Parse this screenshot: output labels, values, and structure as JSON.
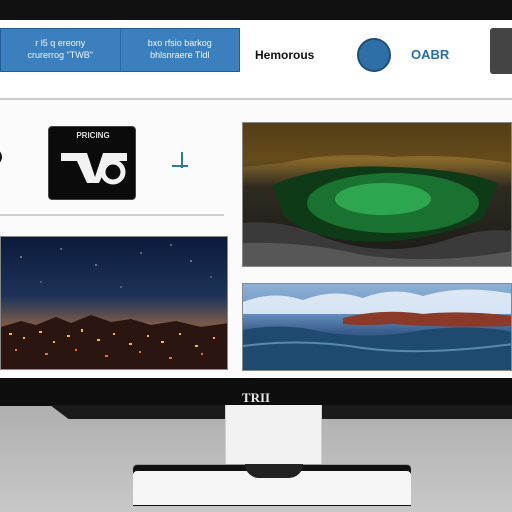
{
  "header": {
    "nav_items": [
      {
        "line1": "r l5 q ereony",
        "line2": "crurerrog \"TWB\""
      },
      {
        "line1": "bxo rfsio barkog",
        "line2": "bhlsnraere Tldl"
      }
    ],
    "brand_title": "Hemorous",
    "link_label": "OABR"
  },
  "panel": {
    "logo_top_text": "PRICING"
  },
  "screen_images": [
    {
      "name": "night-city",
      "alt": "Night city skyline"
    },
    {
      "name": "lagoon",
      "alt": "Green lagoon in a rocky cave"
    },
    {
      "name": "seascape",
      "alt": "Ocean waves with clouds"
    }
  ],
  "monitor": {
    "brand": "TRII"
  },
  "colors": {
    "nav_blue": "#3c7fbe",
    "accent_blue": "#2a6fa8",
    "bezel": "#0d0d0d"
  }
}
